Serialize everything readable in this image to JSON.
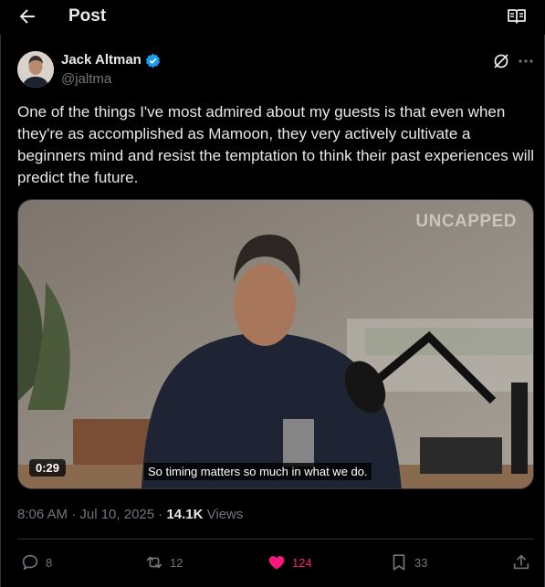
{
  "header": {
    "title": "Post"
  },
  "author": {
    "name": "Jack Altman",
    "handle": "@jaltma",
    "verified": true
  },
  "tweet": {
    "text": "One of the things I've most admired about my guests is that even when they're as accomplished as Mamoon, they very actively cultivate a beginners mind and resist the temptation to think their past experiences will predict the future."
  },
  "media": {
    "watermark": "UNCAPPED",
    "duration": "0:29",
    "caption": "So timing matters so much in what we do."
  },
  "meta": {
    "timestamp": "8:06 AM · Jul 10, 2025 · ",
    "views_count": "14.1K",
    "views_label": " Views"
  },
  "actions": {
    "replies": "8",
    "reposts": "12",
    "likes": "124",
    "bookmarks": "33"
  },
  "colors": {
    "background": "#000000",
    "text": "#e7e9ea",
    "muted": "#71767b",
    "like": "#f91880",
    "verified": "#1d9bf0"
  },
  "icons": {
    "back": "arrow-left-icon",
    "reader": "book-open-icon",
    "verified": "verified-badge-icon",
    "grok": "grok-icon",
    "more": "ellipsis-icon",
    "reply": "comment-icon",
    "repost": "repost-icon",
    "like": "heart-filled-icon",
    "bookmark": "bookmark-icon",
    "share": "share-icon"
  }
}
